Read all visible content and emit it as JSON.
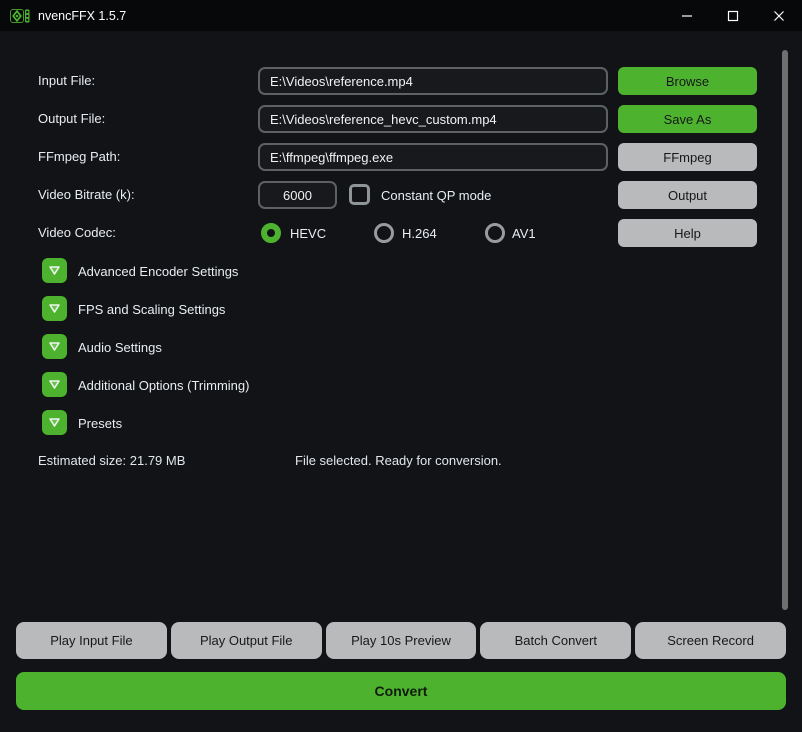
{
  "titlebar": {
    "title": "nvencFFX 1.5.7",
    "app_icon": "nvencffx-logo-icon",
    "controls": [
      "minimize",
      "maximize",
      "close"
    ]
  },
  "colors": {
    "accent_green": "#4db32e",
    "button_gray": "#b9babc",
    "window_bg": "#111316",
    "titlebar_bg": "#060809"
  },
  "form": {
    "input_file": {
      "label": "Input File:",
      "value": "E:\\Videos\\reference.mp4",
      "button": "Browse"
    },
    "output_file": {
      "label": "Output File:",
      "value": "E:\\Videos\\reference_hevc_custom.mp4",
      "button": "Save As"
    },
    "ffmpeg_path": {
      "label": "FFmpeg Path:",
      "value": "E:\\ffmpeg\\ffmpeg.exe",
      "button": "FFmpeg"
    },
    "bitrate": {
      "label": "Video Bitrate (k):",
      "value": "6000",
      "checkbox_label": "Constant QP mode",
      "checkbox_checked": false,
      "button": "Output"
    },
    "codec": {
      "label": "Video Codec:",
      "options": [
        {
          "label": "HEVC",
          "selected": true
        },
        {
          "label": "H.264",
          "selected": false
        },
        {
          "label": "AV1",
          "selected": false
        }
      ],
      "button": "Help"
    }
  },
  "sections": [
    {
      "label": "Advanced Encoder Settings",
      "icon": "collapse-arrow-down-icon"
    },
    {
      "label": "FPS and Scaling Settings",
      "icon": "collapse-arrow-down-icon"
    },
    {
      "label": "Audio Settings",
      "icon": "collapse-arrow-down-icon"
    },
    {
      "label": "Additional Options (Trimming)",
      "icon": "collapse-arrow-down-icon"
    },
    {
      "label": "Presets",
      "icon": "collapse-arrow-down-icon"
    }
  ],
  "status": {
    "estimated_size": "Estimated size: 21.79 MB",
    "message": "File selected. Ready for conversion."
  },
  "bottom_buttons": [
    {
      "label": "Play Input File"
    },
    {
      "label": "Play Output File"
    },
    {
      "label": "Play 10s Preview"
    },
    {
      "label": "Batch Convert"
    },
    {
      "label": "Screen Record"
    }
  ],
  "convert_label": "Convert"
}
